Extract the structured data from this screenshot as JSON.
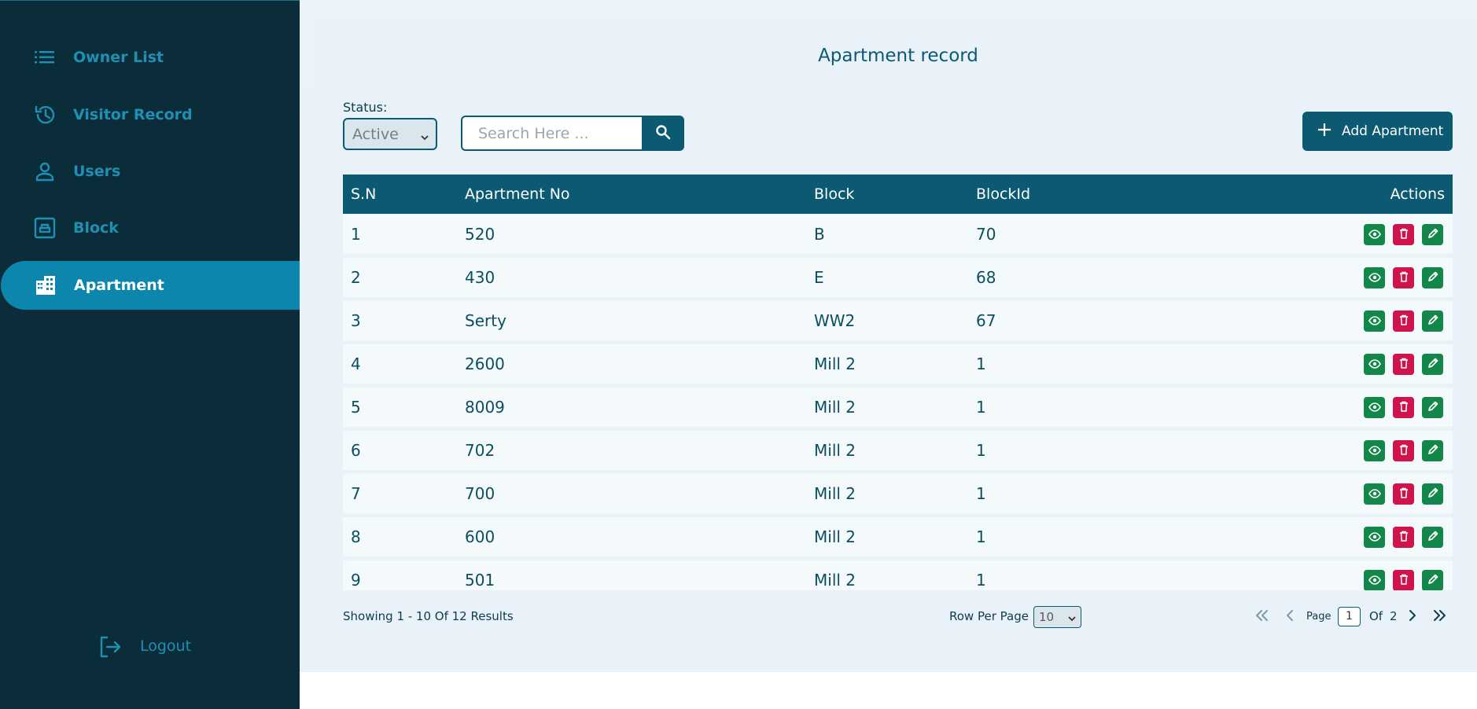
{
  "sidebar": {
    "items": [
      {
        "label": "Owner List",
        "icon": "list-icon"
      },
      {
        "label": "Visitor Record",
        "icon": "history-icon"
      },
      {
        "label": "Users",
        "icon": "user-icon"
      },
      {
        "label": "Block",
        "icon": "block-icon"
      },
      {
        "label": "Apartment",
        "icon": "building-icon",
        "active": true
      }
    ],
    "logout_label": "Logout"
  },
  "page": {
    "title": "Apartment record",
    "status_label": "Status:",
    "status_value": "Active",
    "search_placeholder": "Search Here ...",
    "add_button_label": "Add Apartment"
  },
  "table": {
    "headers": [
      "S.N",
      "Apartment No",
      "Block",
      "BlockId",
      "Actions"
    ],
    "rows": [
      {
        "sn": "1",
        "apartment_no": "520",
        "block": "B",
        "block_id": "70"
      },
      {
        "sn": "2",
        "apartment_no": "430",
        "block": "E",
        "block_id": "68"
      },
      {
        "sn": "3",
        "apartment_no": "Serty",
        "block": "WW2",
        "block_id": "67"
      },
      {
        "sn": "4",
        "apartment_no": "2600",
        "block": "Mill 2",
        "block_id": "1"
      },
      {
        "sn": "5",
        "apartment_no": "8009",
        "block": "Mill 2",
        "block_id": "1"
      },
      {
        "sn": "6",
        "apartment_no": "702",
        "block": "Mill 2",
        "block_id": "1"
      },
      {
        "sn": "7",
        "apartment_no": "700",
        "block": "Mill 2",
        "block_id": "1"
      },
      {
        "sn": "8",
        "apartment_no": "600",
        "block": "Mill 2",
        "block_id": "1"
      },
      {
        "sn": "9",
        "apartment_no": "501",
        "block": "Mill 2",
        "block_id": "1"
      }
    ]
  },
  "footer": {
    "showing": "Showing 1 - 10 Of 12 Results",
    "rows_per_page_label": "Row Per Page",
    "rows_per_page_value": "10",
    "page_label": "Page",
    "current_page": "1",
    "of_label": "Of",
    "total_pages": "2"
  },
  "colors": {
    "sidebar_bg": "#0b2d3a",
    "sidebar_active": "#0c86ad",
    "primary": "#0b5a72",
    "view_btn": "#13864a",
    "delete_btn": "#d0134a",
    "edit_btn": "#13864a"
  }
}
